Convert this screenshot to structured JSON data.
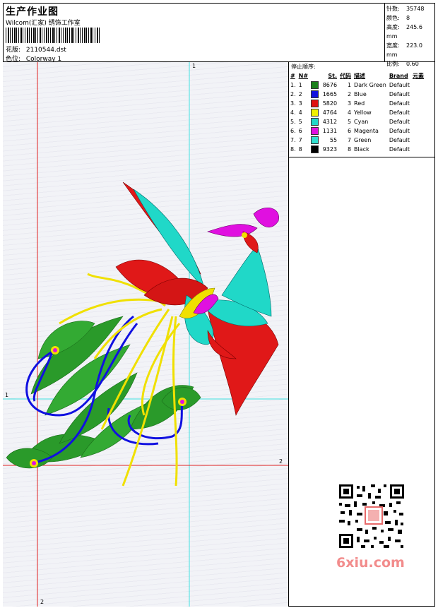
{
  "header": {
    "title": "生产作业图",
    "studio": "Wilcom(汇家) 绣饰工作室",
    "design_label": "花版:",
    "design_value": "2110544.dst",
    "colorway_label": "色位:",
    "colorway_value": "Colorway 1"
  },
  "stats": {
    "stitches_label": "针数:",
    "stitches_value": "35748",
    "colors_label": "颜色:",
    "colors_value": "8",
    "height_label": "高度:",
    "height_value": "245.6 mm",
    "width_label": "宽度:",
    "width_value": "223.0 mm",
    "scale_label": "比例:",
    "scale_value": "0.60"
  },
  "stop_sequence": {
    "title": "停止顺序:",
    "columns": [
      "#",
      "N#",
      "St.",
      "代码",
      "描述",
      "Brand",
      "元素"
    ],
    "rows": [
      {
        "idx": "1.",
        "n": "1",
        "color": "#1a7f1a",
        "st": "8676",
        "code": "1",
        "desc": "Dark Green",
        "brand": "Default"
      },
      {
        "idx": "2.",
        "n": "2",
        "color": "#1010e0",
        "st": "1665",
        "code": "2",
        "desc": "Blue",
        "brand": "Default"
      },
      {
        "idx": "3.",
        "n": "3",
        "color": "#e01010",
        "st": "5820",
        "code": "3",
        "desc": "Red",
        "brand": "Default"
      },
      {
        "idx": "4.",
        "n": "4",
        "color": "#f0f000",
        "st": "4764",
        "code": "4",
        "desc": "Yellow",
        "brand": "Default"
      },
      {
        "idx": "5.",
        "n": "5",
        "color": "#20d8c8",
        "st": "4312",
        "code": "5",
        "desc": "Cyan",
        "brand": "Default"
      },
      {
        "idx": "6.",
        "n": "6",
        "color": "#e010e0",
        "st": "1131",
        "code": "6",
        "desc": "Magenta",
        "brand": "Default"
      },
      {
        "idx": "7.",
        "n": "7",
        "color": "#30e0d0",
        "st": "55",
        "code": "7",
        "desc": "Green",
        "brand": "Default"
      },
      {
        "idx": "8.",
        "n": "8",
        "color": "#000000",
        "st": "9323",
        "code": "8",
        "desc": "Black",
        "brand": "Default"
      }
    ]
  },
  "guides": {
    "marker_1": "1",
    "marker_2": "2"
  },
  "watermark": "6xiu.com"
}
